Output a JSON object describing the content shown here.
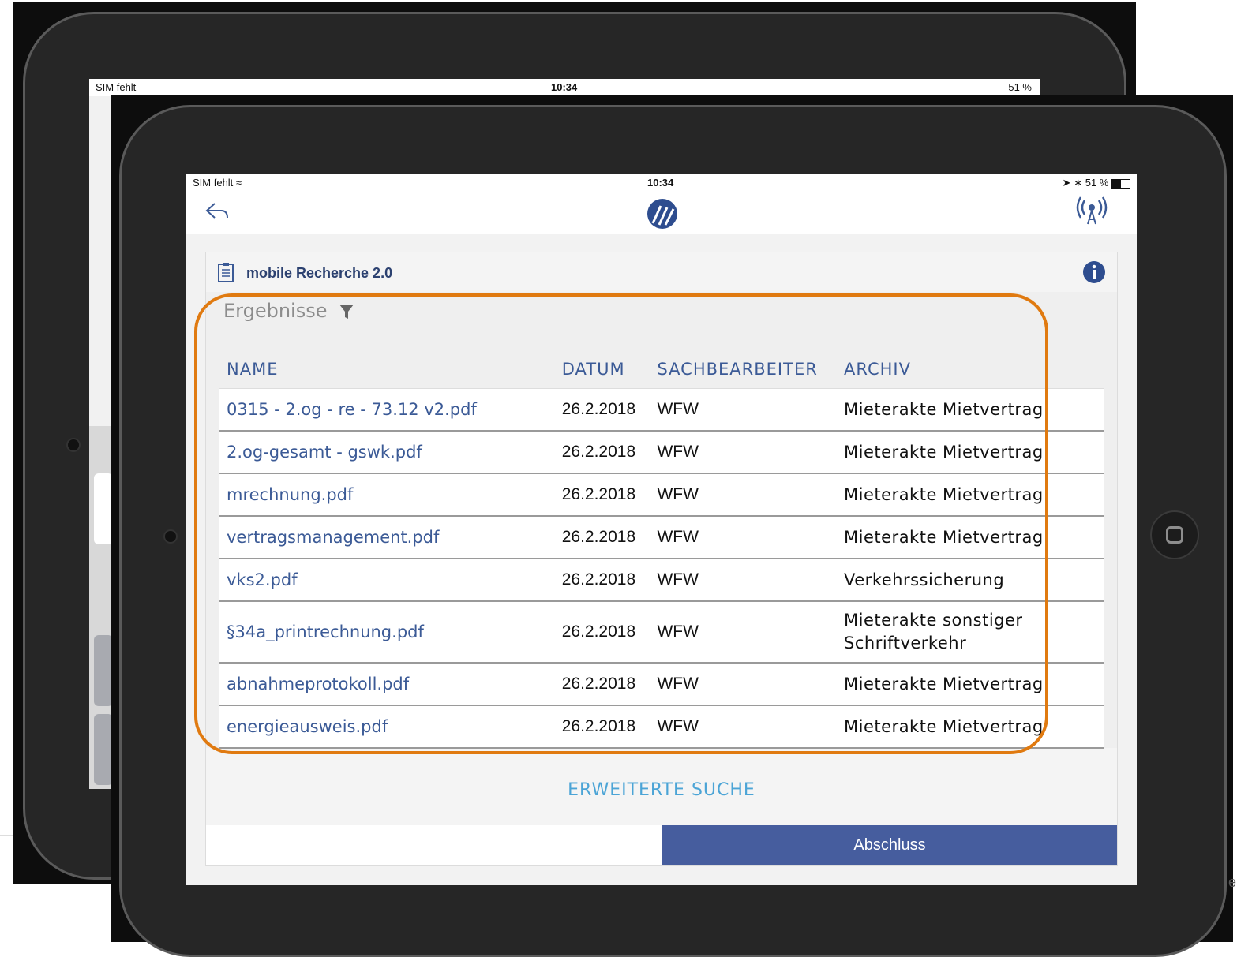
{
  "status_bar": {
    "carrier": "SIM fehlt",
    "time": "10:34",
    "battery": "51 %"
  },
  "back_status_bar": {
    "carrier": "SIM fehlt",
    "time": "10:34",
    "battery": "51 %"
  },
  "header": {
    "icons": [
      "back-arrow-icon",
      "logo-icon",
      "signal-broadcast-icon"
    ]
  },
  "card": {
    "title": "mobile Recherche 2.0",
    "icons": [
      "clipboard-icon",
      "info-icon"
    ]
  },
  "results": {
    "title": "Ergebnisse",
    "filter_icon": "filter-icon",
    "columns": [
      "NAME",
      "DATUM",
      "SACHBEARBEITER",
      "ARCHIV"
    ],
    "rows": [
      {
        "name": "0315 - 2.og - re - 73.12 v2.pdf",
        "date": "26.2.2018",
        "user": "WFW",
        "archive": "Mieterakte Mietvertrag"
      },
      {
        "name": "2.og-gesamt - gswk.pdf",
        "date": "26.2.2018",
        "user": "WFW",
        "archive": "Mieterakte Mietvertrag"
      },
      {
        "name": "mrechnung.pdf",
        "date": "26.2.2018",
        "user": "WFW",
        "archive": "Mieterakte Mietvertrag"
      },
      {
        "name": "vertragsmanagement.pdf",
        "date": "26.2.2018",
        "user": "WFW",
        "archive": "Mieterakte Mietvertrag"
      },
      {
        "name": "vks2.pdf",
        "date": "26.2.2018",
        "user": "WFW",
        "archive": "Verkehrssicherung"
      },
      {
        "name": "§34a_printrechnung.pdf",
        "date": "26.2.2018",
        "user": "WFW",
        "archive": "Mieterakte sonstiger Schriftverkehr"
      },
      {
        "name": "abnahmeprotokoll.pdf",
        "date": "26.2.2018",
        "user": "WFW",
        "archive": "Mieterakte Mietvertrag"
      },
      {
        "name": "energieausweis.pdf",
        "date": "26.2.2018",
        "user": "WFW",
        "archive": "Mieterakte Mietvertrag"
      }
    ]
  },
  "actions": {
    "extended_search": "ERWEITERTE SUCHE",
    "finish": "Abschluss"
  },
  "colors": {
    "primary": "#465d9e",
    "link": "#3b5a96",
    "accent": "#4ba4d6",
    "highlight": "#e07a10"
  }
}
